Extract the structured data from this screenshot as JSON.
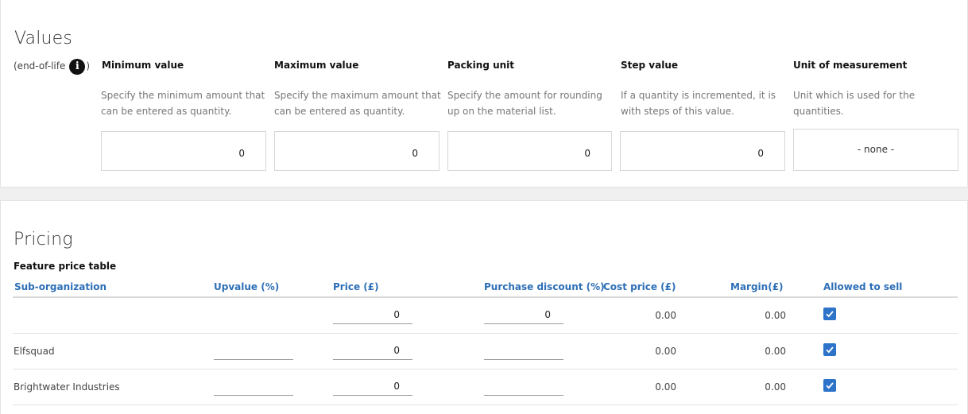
{
  "values": {
    "title": "Values",
    "eol_label": "(end-of-life",
    "eol_close": ")",
    "info_glyph": "i",
    "fields": [
      {
        "label": "Minimum value",
        "description": "Specify the minimum amount that can be entered as quantity.",
        "value": "0"
      },
      {
        "label": "Maximum value",
        "description": "Specify the maximum amount that can be entered as quantity.",
        "value": "0"
      },
      {
        "label": "Packing unit",
        "description": "Specify the amount for rounding up on the material list.",
        "value": "0"
      },
      {
        "label": "Step value",
        "description": "If a quantity is incremented, it is with steps of this value.",
        "value": "0"
      },
      {
        "label": "Unit of measurement",
        "description": "Unit which is used for the quantities.",
        "value": "- none -"
      }
    ]
  },
  "pricing": {
    "title": "Pricing",
    "table_title": "Feature price table",
    "columns": [
      "Sub-organization",
      "Upvalue (%)",
      "Price (£)",
      "Purchase discount (%)",
      "Cost price (£)",
      "Margin(£)",
      "Allowed to sell"
    ],
    "rows": [
      {
        "org": "",
        "upvalue": "",
        "price": "0",
        "discount": "0",
        "cost": "0.00",
        "margin": "0.00",
        "allowed": true
      },
      {
        "org": "Elfsquad",
        "upvalue": "",
        "price": "0",
        "discount": "",
        "cost": "0.00",
        "margin": "0.00",
        "allowed": true
      },
      {
        "org": "Brightwater Industries",
        "upvalue": "",
        "price": "0",
        "discount": "",
        "cost": "0.00",
        "margin": "0.00",
        "allowed": true
      }
    ]
  },
  "colors": {
    "accent": "#2d6fb7",
    "checkbox": "#2d73c9"
  },
  "icons": {
    "info": "info-icon",
    "check": "check-icon"
  }
}
